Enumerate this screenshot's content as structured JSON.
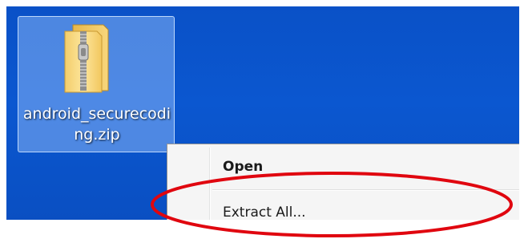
{
  "desktop": {
    "icon": {
      "name": "zip-folder-icon",
      "label": "android_securecoding.zip"
    }
  },
  "context_menu": {
    "items": [
      {
        "label": "Open",
        "default": true
      },
      {
        "label": "Extract All..."
      }
    ]
  },
  "annotation": {
    "color": "#e0060f"
  }
}
